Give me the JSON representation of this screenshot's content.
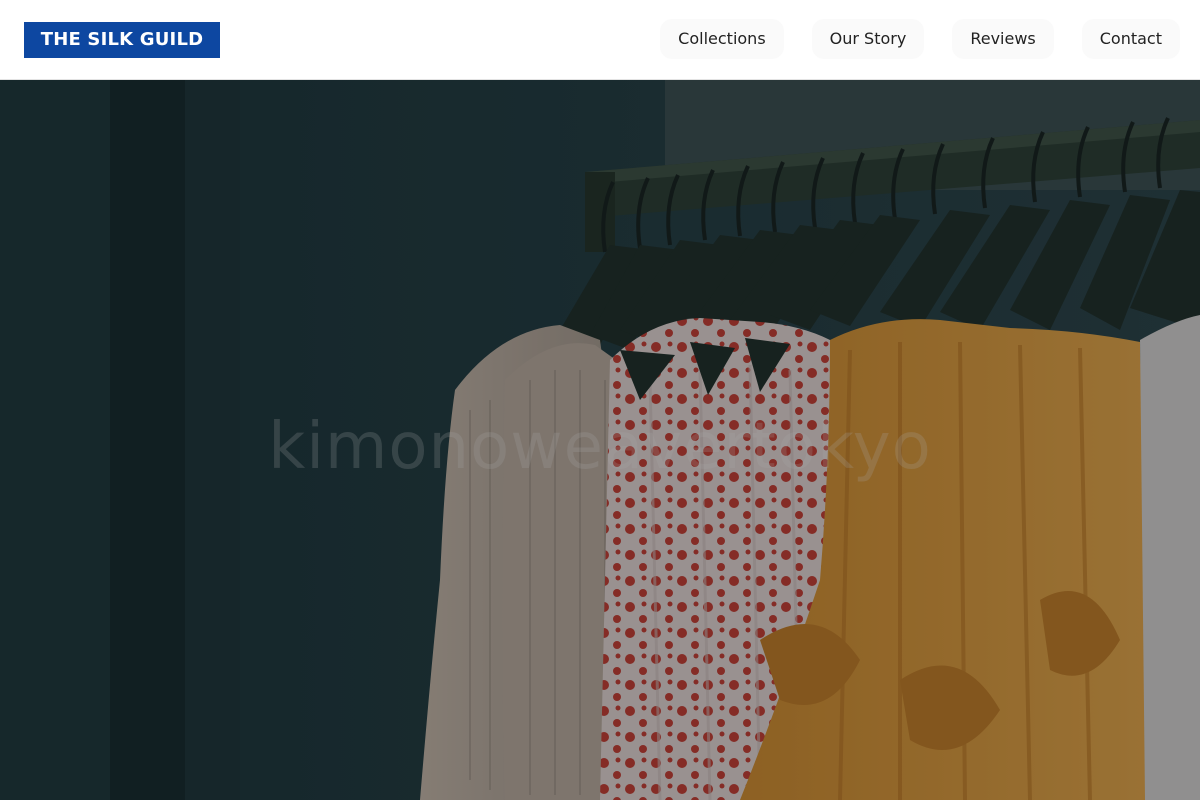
{
  "brand": {
    "name": "THE SILK GUILD",
    "color": "#0d47a1"
  },
  "nav": {
    "items": [
      {
        "label": "Collections"
      },
      {
        "label": "Our Story"
      },
      {
        "label": "Reviews"
      },
      {
        "label": "Contact"
      }
    ]
  },
  "hero": {
    "image": "clothing-rack-photo",
    "watermark": "kimonoweavertokyo",
    "overlay_color": "#0b1418"
  }
}
